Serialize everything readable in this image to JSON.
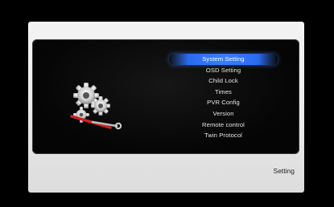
{
  "screen": {
    "footer_label": "Setting"
  },
  "menu": {
    "selected_index": 0,
    "items": [
      {
        "label": "System Setting"
      },
      {
        "label": "OSD Setting"
      },
      {
        "label": "Child Lock"
      },
      {
        "label": "Times"
      },
      {
        "label": "PVR Config"
      },
      {
        "label": "Version"
      },
      {
        "label": "Remote control"
      },
      {
        "label": "Twin Protocol"
      }
    ]
  },
  "colors": {
    "highlight": "#3a7cff",
    "panel": "#050505",
    "frame": "#eeeeee"
  },
  "icons": {
    "emblem": "gears-and-wrench-icon"
  }
}
